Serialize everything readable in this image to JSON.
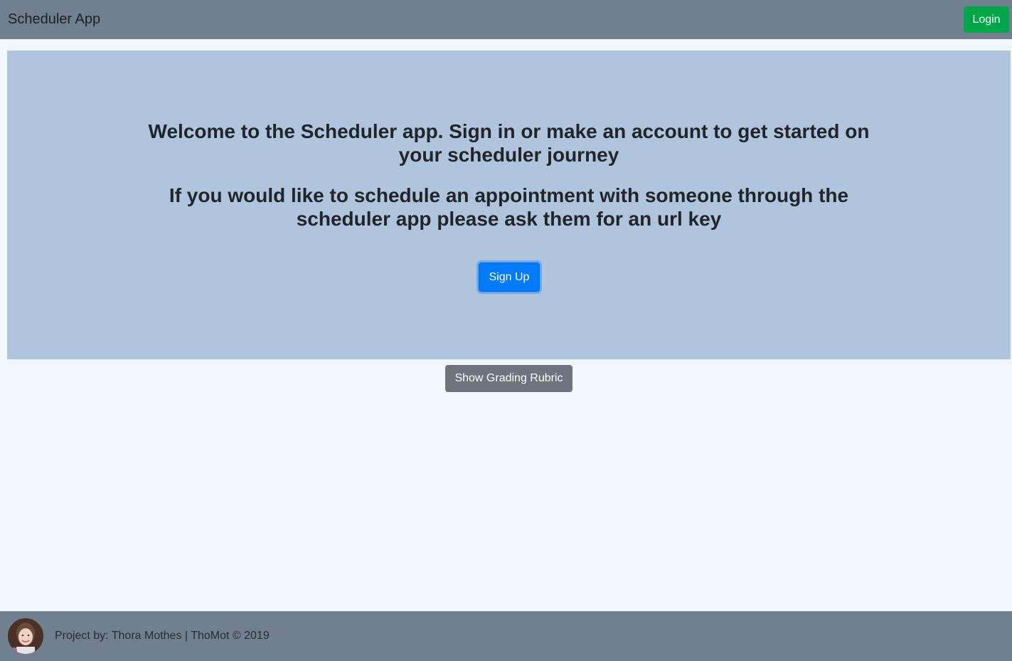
{
  "navbar": {
    "brand": "Scheduler App",
    "login_label": "Login"
  },
  "hero": {
    "welcome_text": "Welcome to the Scheduler app. Sign in or make an account to get started on your scheduler journey",
    "info_text": "If you would like to schedule an appointment with someone through the scheduler app please ask them for an url key",
    "signup_label": "Sign Up"
  },
  "rubric_label": "Show Grading Rubric",
  "footer": {
    "text": "Project by: Thora Mothes | ThoMot © 2019",
    "avatar_icon": "avatar-photo-icon"
  },
  "colors": {
    "navbar_bg": "#708090",
    "page_bg": "#f0f8ff",
    "hero_bg": "#b0c4de",
    "login_btn": "#00a74a",
    "signup_btn": "#007bff",
    "rubric_btn": "#6c757d"
  }
}
